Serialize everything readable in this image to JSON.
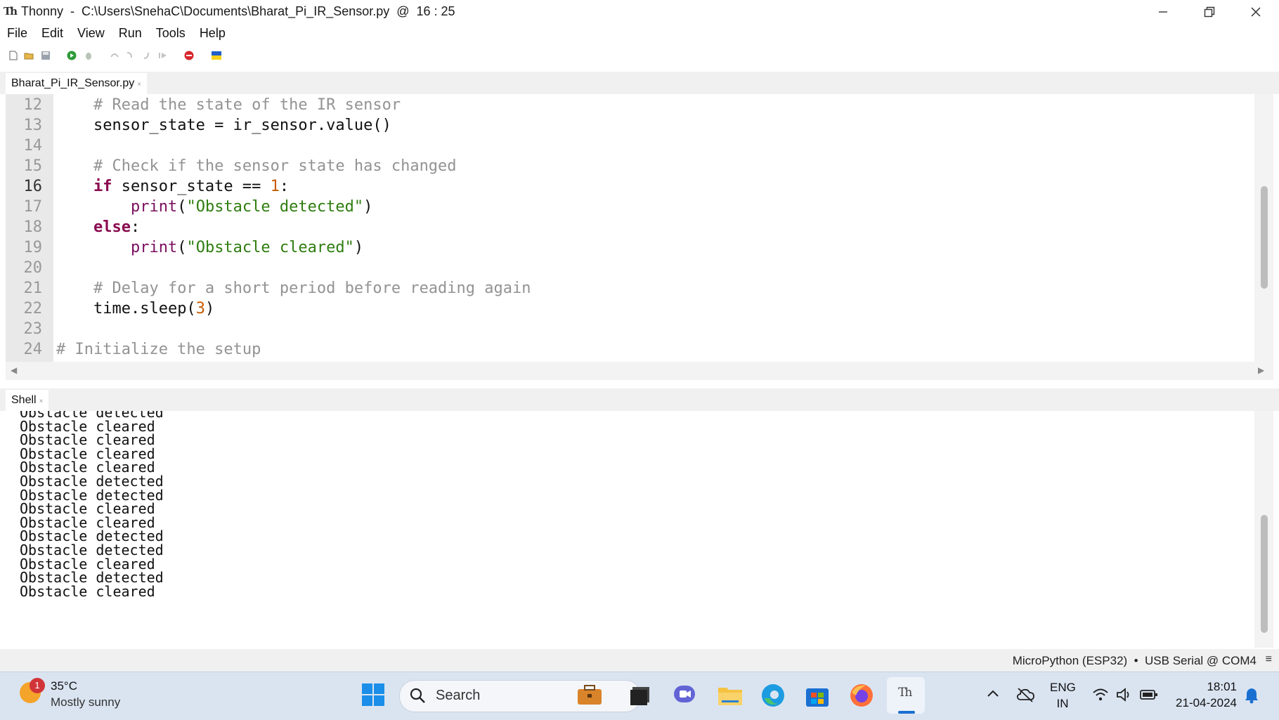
{
  "window": {
    "title": "Thonny  -  C:\\Users\\SnehaC\\Documents\\Bharat_Pi_IR_Sensor.py  @  16 : 25",
    "icons": [
      "thonny-app-icon",
      "minimize-icon",
      "restore-icon",
      "close-icon"
    ]
  },
  "menu": [
    "File",
    "Edit",
    "View",
    "Run",
    "Tools",
    "Help"
  ],
  "toolbar": {
    "icons": [
      "new-file-icon",
      "open-file-icon",
      "save-icon",
      "run-icon",
      "debug-icon",
      "step-over-icon",
      "step-into-icon",
      "step-out-icon",
      "resume-icon",
      "stop-icon",
      "ukraine-flag-icon"
    ]
  },
  "editor": {
    "tab_label": "Bharat_Pi_IR_Sensor.py",
    "tab_close": "×",
    "current_line": "16",
    "lines": [
      {
        "n": "12",
        "indent": "    ",
        "tokens": [
          {
            "t": "# Read the state of the IR sensor",
            "c": "cm"
          }
        ]
      },
      {
        "n": "13",
        "indent": "    ",
        "tokens": [
          {
            "t": "sensor_state = ir_sensor.value()",
            "c": ""
          }
        ]
      },
      {
        "n": "14",
        "indent": "",
        "tokens": []
      },
      {
        "n": "15",
        "indent": "    ",
        "tokens": [
          {
            "t": "# Check if the sensor state has changed",
            "c": "cm"
          }
        ]
      },
      {
        "n": "16",
        "indent": "    ",
        "tokens": [
          {
            "t": "if",
            "c": "kw"
          },
          {
            "t": " sensor_state == ",
            "c": ""
          },
          {
            "t": "1",
            "c": "nm"
          },
          {
            "t": ":",
            "c": ""
          }
        ]
      },
      {
        "n": "17",
        "indent": "        ",
        "tokens": [
          {
            "t": "print",
            "c": "bi"
          },
          {
            "t": "(",
            "c": ""
          },
          {
            "t": "\"Obstacle detected\"",
            "c": "st"
          },
          {
            "t": ")",
            "c": ""
          }
        ]
      },
      {
        "n": "18",
        "indent": "    ",
        "tokens": [
          {
            "t": "else",
            "c": "kw"
          },
          {
            "t": ":",
            "c": ""
          }
        ]
      },
      {
        "n": "19",
        "indent": "        ",
        "tokens": [
          {
            "t": "print",
            "c": "bi"
          },
          {
            "t": "(",
            "c": ""
          },
          {
            "t": "\"Obstacle cleared\"",
            "c": "st"
          },
          {
            "t": ")",
            "c": ""
          }
        ]
      },
      {
        "n": "20",
        "indent": "",
        "tokens": []
      },
      {
        "n": "21",
        "indent": "    ",
        "tokens": [
          {
            "t": "# Delay for a short period before reading again",
            "c": "cm"
          }
        ]
      },
      {
        "n": "22",
        "indent": "    ",
        "tokens": [
          {
            "t": "time.sleep(",
            "c": ""
          },
          {
            "t": "3",
            "c": "nm"
          },
          {
            "t": ")",
            "c": ""
          }
        ]
      },
      {
        "n": "23",
        "indent": "",
        "tokens": []
      },
      {
        "n": "24",
        "indent": "",
        "tokens": [
          {
            "t": "# Initialize the setup",
            "c": "cm"
          }
        ]
      }
    ]
  },
  "shell": {
    "tab_label": "Shell",
    "tab_close": "×",
    "lines": [
      "Obstacle detected",
      "Obstacle cleared",
      "Obstacle cleared",
      "Obstacle cleared",
      "Obstacle cleared",
      "Obstacle detected",
      "Obstacle detected",
      "Obstacle cleared",
      "Obstacle cleared",
      "Obstacle detected",
      "Obstacle detected",
      "Obstacle cleared",
      "Obstacle detected",
      "Obstacle cleared"
    ]
  },
  "statusbar": {
    "text": "MicroPython (ESP32)  •  USB Serial @ COM4",
    "menu_icon": "≡"
  },
  "taskbar": {
    "weather_badge": "1",
    "temperature": "35°C",
    "weather": "Mostly sunny",
    "search_label": "Search",
    "language_line1": "ENG",
    "language_line2": "IN",
    "time": "18:01",
    "date": "21-04-2024",
    "app_icons": [
      "windows-start-icon",
      "search-icon",
      "briefcase-icon",
      "task-view-icon",
      "chat-icon",
      "file-explorer-icon",
      "edge-icon",
      "store-icon",
      "firefox-icon",
      "thonny-taskbar-icon"
    ],
    "tray_icons": [
      "chevron-up-icon",
      "cloud-offline-icon",
      "wifi-icon",
      "volume-icon",
      "battery-icon",
      "notification-bell-icon"
    ]
  }
}
